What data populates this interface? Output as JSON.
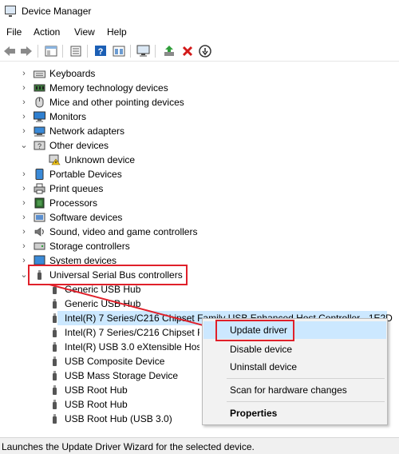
{
  "window": {
    "title": "Device Manager",
    "icon": "device-manager-icon"
  },
  "menu": [
    "File",
    "Action",
    "View",
    "Help"
  ],
  "toolbar": {
    "buttons": [
      "back-icon",
      "forward-icon",
      "show-hide-tree-icon",
      "properties-icon",
      "help-icon",
      "show-hidden-icon",
      "scan-hardware-icon",
      "update-driver-icon",
      "uninstall-icon",
      "disable-icon"
    ],
    "colors": {
      "accent_green": "#2f9e3a",
      "delete_red": "#d31a1a",
      "help_blue": "#1c5fb5"
    }
  },
  "tree": [
    {
      "label": "Keyboards",
      "icon": "keyboard-icon",
      "expanded": false
    },
    {
      "label": "Memory technology devices",
      "icon": "memory-icon",
      "expanded": false
    },
    {
      "label": "Mice and other pointing devices",
      "icon": "mouse-icon",
      "expanded": false
    },
    {
      "label": "Monitors",
      "icon": "monitor-icon",
      "expanded": false
    },
    {
      "label": "Network adapters",
      "icon": "network-icon",
      "expanded": false
    },
    {
      "label": "Other devices",
      "icon": "other-devices-icon",
      "expanded": true
    },
    {
      "label": "Unknown device",
      "icon": "unknown-device-warning-icon",
      "child": true
    },
    {
      "label": "Portable Devices",
      "icon": "portable-device-icon",
      "expanded": false
    },
    {
      "label": "Print queues",
      "icon": "printer-icon",
      "expanded": false
    },
    {
      "label": "Processors",
      "icon": "processor-icon",
      "expanded": false
    },
    {
      "label": "Software devices",
      "icon": "software-device-icon",
      "expanded": false
    },
    {
      "label": "Sound, video and game controllers",
      "icon": "speaker-icon",
      "expanded": false
    },
    {
      "label": "Storage controllers",
      "icon": "storage-icon",
      "expanded": false
    },
    {
      "label": "System devices",
      "icon": "system-icon",
      "expanded": false
    },
    {
      "label": "Universal Serial Bus controllers",
      "icon": "usb-icon",
      "expanded": true
    },
    {
      "label": "Generic USB Hub",
      "icon": "usb-icon",
      "child": true
    },
    {
      "label": "Generic USB Hub",
      "icon": "usb-icon",
      "child": true
    },
    {
      "label": "Intel(R) 7 Series/C216 Chipset Family USB Enhanced Host Controller - 1E2D",
      "icon": "usb-icon",
      "child": true,
      "selected": true
    },
    {
      "label": "Intel(R) 7 Series/C216 Chipset Fa",
      "icon": "usb-icon",
      "child": true
    },
    {
      "label": "Intel(R) USB 3.0 eXtensible Host C",
      "icon": "usb-icon",
      "child": true
    },
    {
      "label": "USB Composite Device",
      "icon": "usb-icon",
      "child": true
    },
    {
      "label": "USB Mass Storage Device",
      "icon": "usb-icon",
      "child": true
    },
    {
      "label": "USB Root Hub",
      "icon": "usb-icon",
      "child": true
    },
    {
      "label": "USB Root Hub",
      "icon": "usb-icon",
      "child": true
    },
    {
      "label": "USB Root Hub (USB 3.0)",
      "icon": "usb-icon",
      "child": true
    }
  ],
  "context_menu": {
    "items": [
      "Update driver",
      "Disable device",
      "Uninstall device",
      "Scan for hardware changes",
      "Properties"
    ],
    "highlighted": "Update driver"
  },
  "annotation": {
    "color": "#e0202a"
  },
  "status": "Launches the Update Driver Wizard for the selected device."
}
